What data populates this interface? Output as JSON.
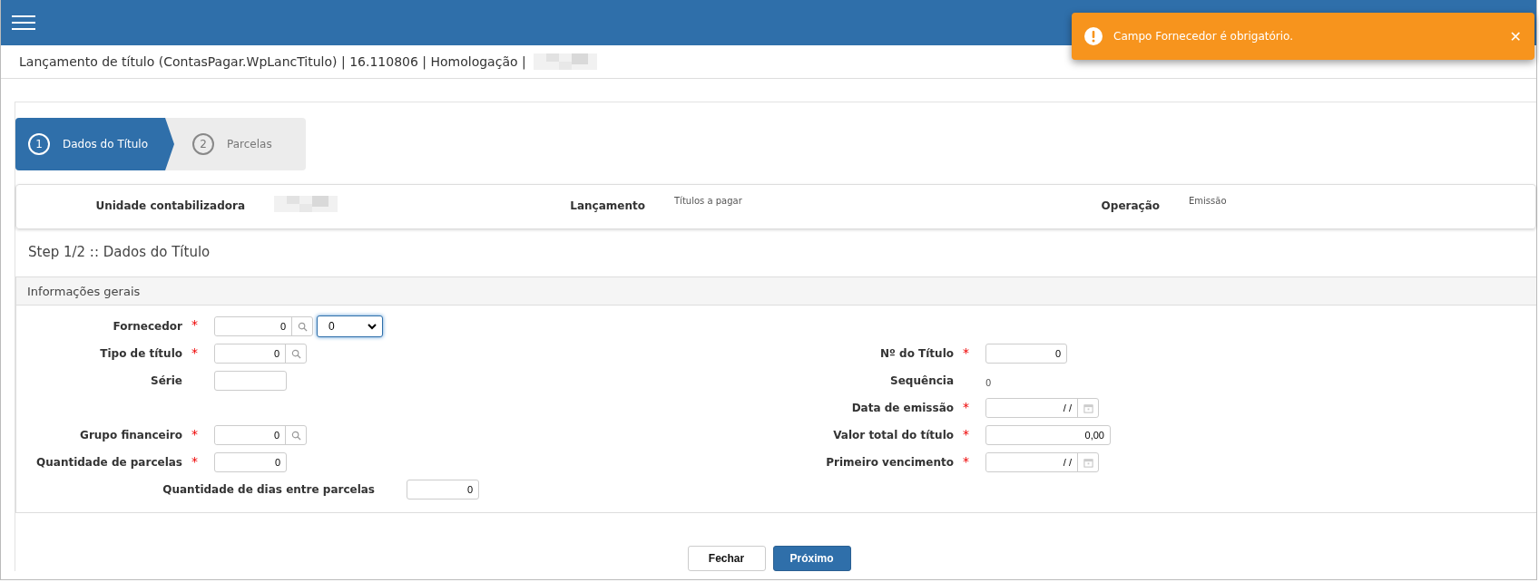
{
  "header": {
    "menu": true
  },
  "toast": {
    "message": "Campo Fornecedor é obrigatório.",
    "close": "✕"
  },
  "title_bar": {
    "text": "Lançamento de título (ContasPagar.WpLancTitulo) | 16.110806 | Homologação |",
    "redacted": true
  },
  "stepper": [
    {
      "number": "1",
      "label": "Dados do Título",
      "selected": true
    },
    {
      "number": "2",
      "label": "Parcelas",
      "selected": false
    }
  ],
  "info": [
    {
      "label": "Unidade contabilizadora",
      "redacted": true
    },
    {
      "label": "Lançamento",
      "value": "Títulos a pagar"
    },
    {
      "label": "Operação",
      "value": "Emissão"
    }
  ],
  "step_heading": "Step 1/2 :: Dados do Título",
  "section": {
    "title": "Informações gerais",
    "rows": [
      {
        "left": {
          "label": "Fornecedor",
          "required_mark": "*",
          "kind": "select-lookup",
          "value": "0",
          "select_value": "0",
          "focused": true
        }
      },
      {
        "left": {
          "label": "Tipo de título",
          "required_mark": "*",
          "kind": "lookup",
          "value": "0"
        },
        "right": {
          "label": "Nº do Título",
          "required_mark": "*",
          "kind": "code",
          "value": "0"
        }
      },
      {
        "left": {
          "label": "Série",
          "kind": "text"
        },
        "right": {
          "label": "Sequência",
          "kind": "display",
          "value": "0"
        }
      },
      {
        "right": {
          "label": "Data de emissão",
          "required_mark": "*",
          "kind": "date",
          "value": "/ /"
        }
      },
      {
        "left": {
          "label": "Grupo financeiro",
          "required_mark": "*",
          "kind": "lookup",
          "value": "0"
        },
        "right": {
          "label": "Valor total do título",
          "required_mark": "*",
          "kind": "money",
          "value": "0,00"
        }
      },
      {
        "left": {
          "label": "Quantidade de parcelas",
          "required_mark": "*",
          "kind": "text",
          "value": "0"
        },
        "right": {
          "label": "Primeiro vencimento",
          "required_mark": "*",
          "kind": "date",
          "value": "/ /"
        }
      },
      {
        "left": {
          "label": "Quantidade de dias entre parcelas",
          "kind": "wide-text",
          "value": "0"
        }
      }
    ]
  },
  "buttons": [
    {
      "label": "Fechar",
      "kind": "secondary"
    },
    {
      "label": "Próximo",
      "kind": "primary"
    }
  ]
}
